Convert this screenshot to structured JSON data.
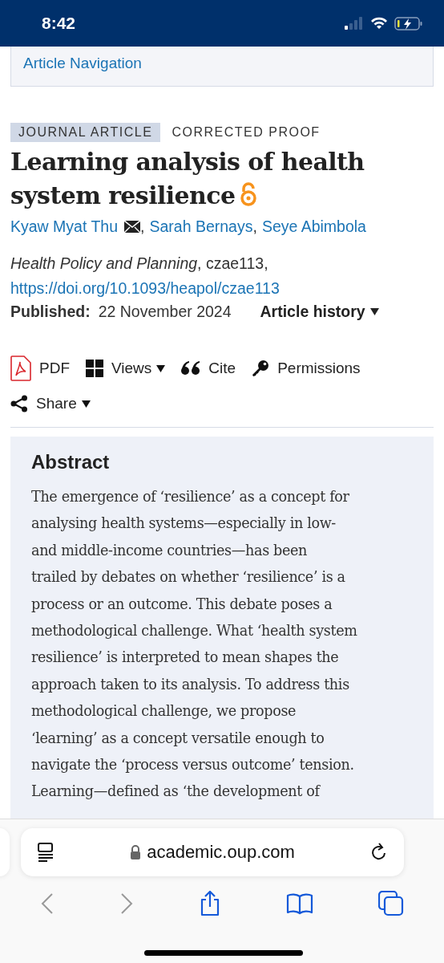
{
  "status_bar": {
    "time": "8:42"
  },
  "article_navigation": {
    "label": "Article Navigation"
  },
  "article": {
    "type_tag": "JOURNAL ARTICLE",
    "status": "CORRECTED PROOF",
    "title": "Learning analysis of health system resilience",
    "open_access": true,
    "authors": [
      {
        "name": "Kyaw Myat Thu",
        "email": true,
        "separator": ","
      },
      {
        "name": "Sarah Bernays",
        "email": false,
        "separator": ","
      },
      {
        "name": "Seye Abimbola",
        "email": false
      }
    ],
    "journal": "Health Policy and Planning",
    "citation_id": ", czae113,",
    "doi": "https://doi.org/10.1093/heapol/czae113",
    "published_label": "Published:",
    "published_date": "22 November 2024",
    "history_label": "Article history"
  },
  "toolbar": [
    {
      "kind": "pdf",
      "label": "PDF",
      "dropdown": false
    },
    {
      "kind": "views",
      "label": "Views",
      "dropdown": true
    },
    {
      "kind": "cite",
      "label": "Cite",
      "dropdown": false
    },
    {
      "kind": "permissions",
      "label": "Permissions",
      "dropdown": false
    },
    {
      "kind": "share",
      "label": "Share",
      "dropdown": true
    }
  ],
  "abstract": {
    "heading": "Abstract",
    "lines": [
      "The emergence of ‘resilience’ as a concept for",
      "analysing health systems—especially in low-",
      "and middle-income countries—has been",
      "trailed by debates on whether ‘resilience’ is a",
      "process or an outcome. This debate poses a",
      "methodological challenge. What ‘health system",
      "resilience’ is interpreted to mean shapes the",
      "approach taken to its analysis. To address this",
      "methodological challenge, we propose",
      "‘learning’ as a concept versatile enough to",
      "navigate the ‘process versus outcome’ tension.",
      "Learning—defined as ‘the development of"
    ]
  },
  "browser": {
    "url": "academic.oup.com",
    "secure": true
  }
}
